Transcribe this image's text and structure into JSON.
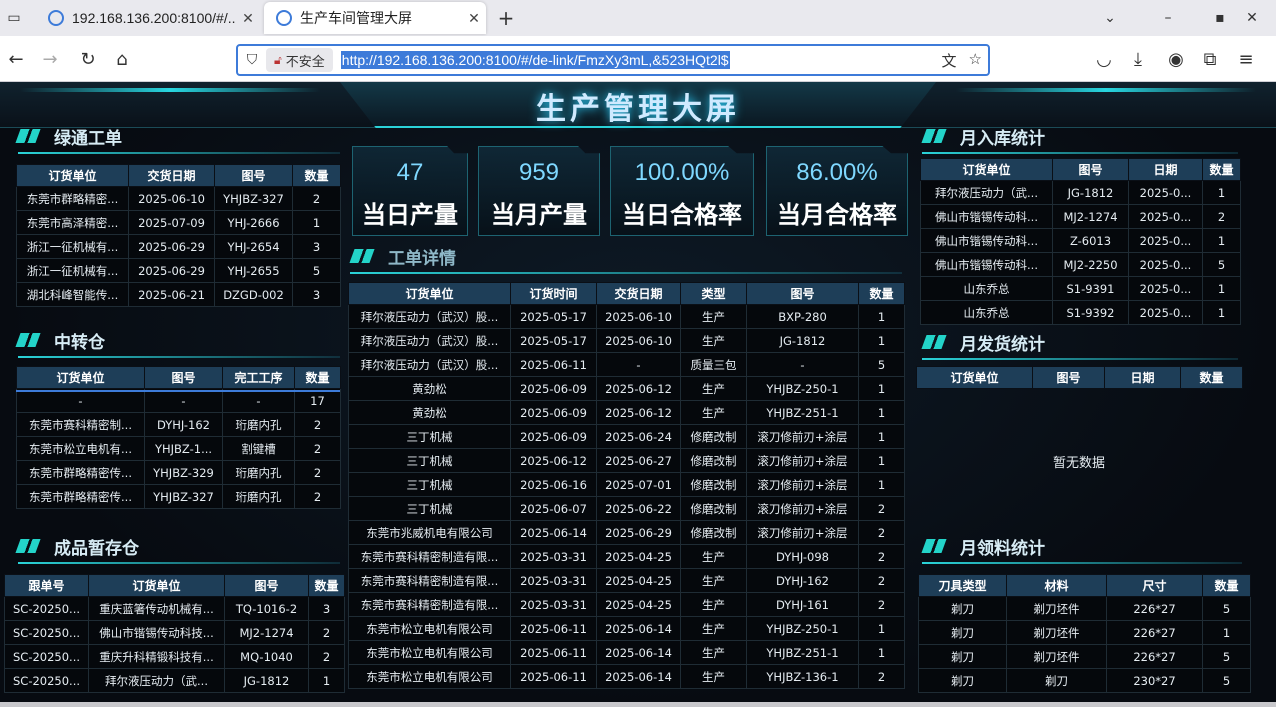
{
  "browser": {
    "tabs": [
      {
        "title": "192.168.136.200:8100/#/..."
      },
      {
        "title": "生产车间管理大屏"
      }
    ],
    "insecure_label": "不安全",
    "url": "http://192.168.136.200:8100/#/de-link/FmzXy3mL,&523HQt2l$"
  },
  "dashboard": {
    "title": "生产管理大屏",
    "kpis": [
      {
        "value": "47",
        "label": "当日产量"
      },
      {
        "value": "959",
        "label": "当月产量"
      },
      {
        "value": "100.00%",
        "label": "当日合格率"
      },
      {
        "value": "86.00%",
        "label": "当月合格率"
      }
    ],
    "green_orders": {
      "title": "绿通工单",
      "columns": [
        "订货单位",
        "交货日期",
        "图号",
        "数量"
      ],
      "rows": [
        [
          "东莞市群略精密...",
          "2025-06-10",
          "YHJBZ-327",
          "2"
        ],
        [
          "东莞市高泽精密...",
          "2025-07-09",
          "YHJ-2666",
          "1"
        ],
        [
          "浙江一征机械有...",
          "2025-06-29",
          "YHJ-2654",
          "3"
        ],
        [
          "浙江一征机械有...",
          "2025-06-29",
          "YHJ-2655",
          "5"
        ],
        [
          "湖北科峰智能传...",
          "2025-06-21",
          "DZGD-002",
          "3"
        ]
      ]
    },
    "transfer": {
      "title": "中转仓",
      "columns": [
        "订货单位",
        "图号",
        "完工工序",
        "数量"
      ],
      "rows": [
        [
          "-",
          "-",
          "-",
          "17"
        ],
        [
          "东莞市赛科精密制...",
          "DYHJ-162",
          "珩磨内孔",
          "2"
        ],
        [
          "东莞市松立电机有...",
          "YHJBZ-1...",
          "割键槽",
          "2"
        ],
        [
          "东莞市群略精密传...",
          "YHJBZ-329",
          "珩磨内孔",
          "2"
        ],
        [
          "东莞市群略精密传...",
          "YHJBZ-327",
          "珩磨内孔",
          "2"
        ]
      ]
    },
    "finished": {
      "title": "成品暂存仓",
      "columns": [
        "跟单号",
        "订货单位",
        "图号",
        "数量"
      ],
      "rows": [
        [
          "SC-20250...",
          "重庆蓝箸传动机械有...",
          "TQ-1016-2",
          "3"
        ],
        [
          "SC-20250...",
          "佛山市锴锡传动科技...",
          "MJ2-1274",
          "2"
        ],
        [
          "SC-20250...",
          "重庆升科精锻科技有...",
          "MQ-1040",
          "2"
        ],
        [
          "SC-20250...",
          "拜尔液压动力（武...",
          "JG-1812",
          "1"
        ]
      ]
    },
    "work_orders": {
      "title": "工单详情",
      "columns": [
        "订货单位",
        "订货时间",
        "交货日期",
        "类型",
        "图号",
        "数量"
      ],
      "rows": [
        [
          "拜尔液压动力（武汉）股...",
          "2025-05-17",
          "2025-06-10",
          "生产",
          "BXP-280",
          "1"
        ],
        [
          "拜尔液压动力（武汉）股...",
          "2025-05-17",
          "2025-06-10",
          "生产",
          "JG-1812",
          "1"
        ],
        [
          "拜尔液压动力（武汉）股...",
          "2025-06-11",
          "-",
          "质量三包",
          "-",
          "5"
        ],
        [
          "黄劲松",
          "2025-06-09",
          "2025-06-12",
          "生产",
          "YHJBZ-250-1",
          "1"
        ],
        [
          "黄劲松",
          "2025-06-09",
          "2025-06-12",
          "生产",
          "YHJBZ-251-1",
          "1"
        ],
        [
          "三丁机械",
          "2025-06-09",
          "2025-06-24",
          "修磨改制",
          "滚刀修前刃+涂层",
          "1"
        ],
        [
          "三丁机械",
          "2025-06-12",
          "2025-06-27",
          "修磨改制",
          "滚刀修前刃+涂层",
          "1"
        ],
        [
          "三丁机械",
          "2025-06-16",
          "2025-07-01",
          "修磨改制",
          "滚刀修前刃+涂层",
          "1"
        ],
        [
          "三丁机械",
          "2025-06-07",
          "2025-06-22",
          "修磨改制",
          "滚刀修前刃+涂层",
          "2"
        ],
        [
          "东莞市兆威机电有限公司",
          "2025-06-14",
          "2025-06-29",
          "修磨改制",
          "滚刀修前刃+涂层",
          "2"
        ],
        [
          "东莞市赛科精密制造有限...",
          "2025-03-31",
          "2025-04-25",
          "生产",
          "DYHJ-098",
          "2"
        ],
        [
          "东莞市赛科精密制造有限...",
          "2025-03-31",
          "2025-04-25",
          "生产",
          "DYHJ-162",
          "2"
        ],
        [
          "东莞市赛科精密制造有限...",
          "2025-03-31",
          "2025-04-25",
          "生产",
          "DYHJ-161",
          "2"
        ],
        [
          "东莞市松立电机有限公司",
          "2025-06-11",
          "2025-06-14",
          "生产",
          "YHJBZ-250-1",
          "1"
        ],
        [
          "东莞市松立电机有限公司",
          "2025-06-11",
          "2025-06-14",
          "生产",
          "YHJBZ-251-1",
          "1"
        ],
        [
          "东莞市松立电机有限公司",
          "2025-06-11",
          "2025-06-14",
          "生产",
          "YHJBZ-136-1",
          "2"
        ]
      ]
    },
    "monthly_in": {
      "title": "月入库统计",
      "columns": [
        "订货单位",
        "图号",
        "日期",
        "数量"
      ],
      "rows": [
        [
          "拜尔液压动力（武...",
          "JG-1812",
          "2025-0...",
          "1"
        ],
        [
          "佛山市锴锡传动科...",
          "MJ2-1274",
          "2025-0...",
          "2"
        ],
        [
          "佛山市锴锡传动科...",
          "Z-6013",
          "2025-0...",
          "1"
        ],
        [
          "佛山市锴锡传动科...",
          "MJ2-2250",
          "2025-0...",
          "5"
        ],
        [
          "山东乔总",
          "S1-9391",
          "2025-0...",
          "1"
        ],
        [
          "山东乔总",
          "S1-9392",
          "2025-0...",
          "1"
        ]
      ]
    },
    "monthly_ship": {
      "title": "月发货统计",
      "columns": [
        "订货单位",
        "图号",
        "日期",
        "数量"
      ],
      "empty_text": "暂无数据"
    },
    "monthly_material": {
      "title": "月领料统计",
      "columns": [
        "刀具类型",
        "材料",
        "尺寸",
        "数量"
      ],
      "rows": [
        [
          "剃刀",
          "剃刀坯件",
          "226*27",
          "5"
        ],
        [
          "剃刀",
          "剃刀坯件",
          "226*27",
          "1"
        ],
        [
          "剃刀",
          "剃刀坯件",
          "226*27",
          "5"
        ],
        [
          "剃刀",
          "剃刀",
          "230*27",
          "5"
        ]
      ]
    }
  }
}
